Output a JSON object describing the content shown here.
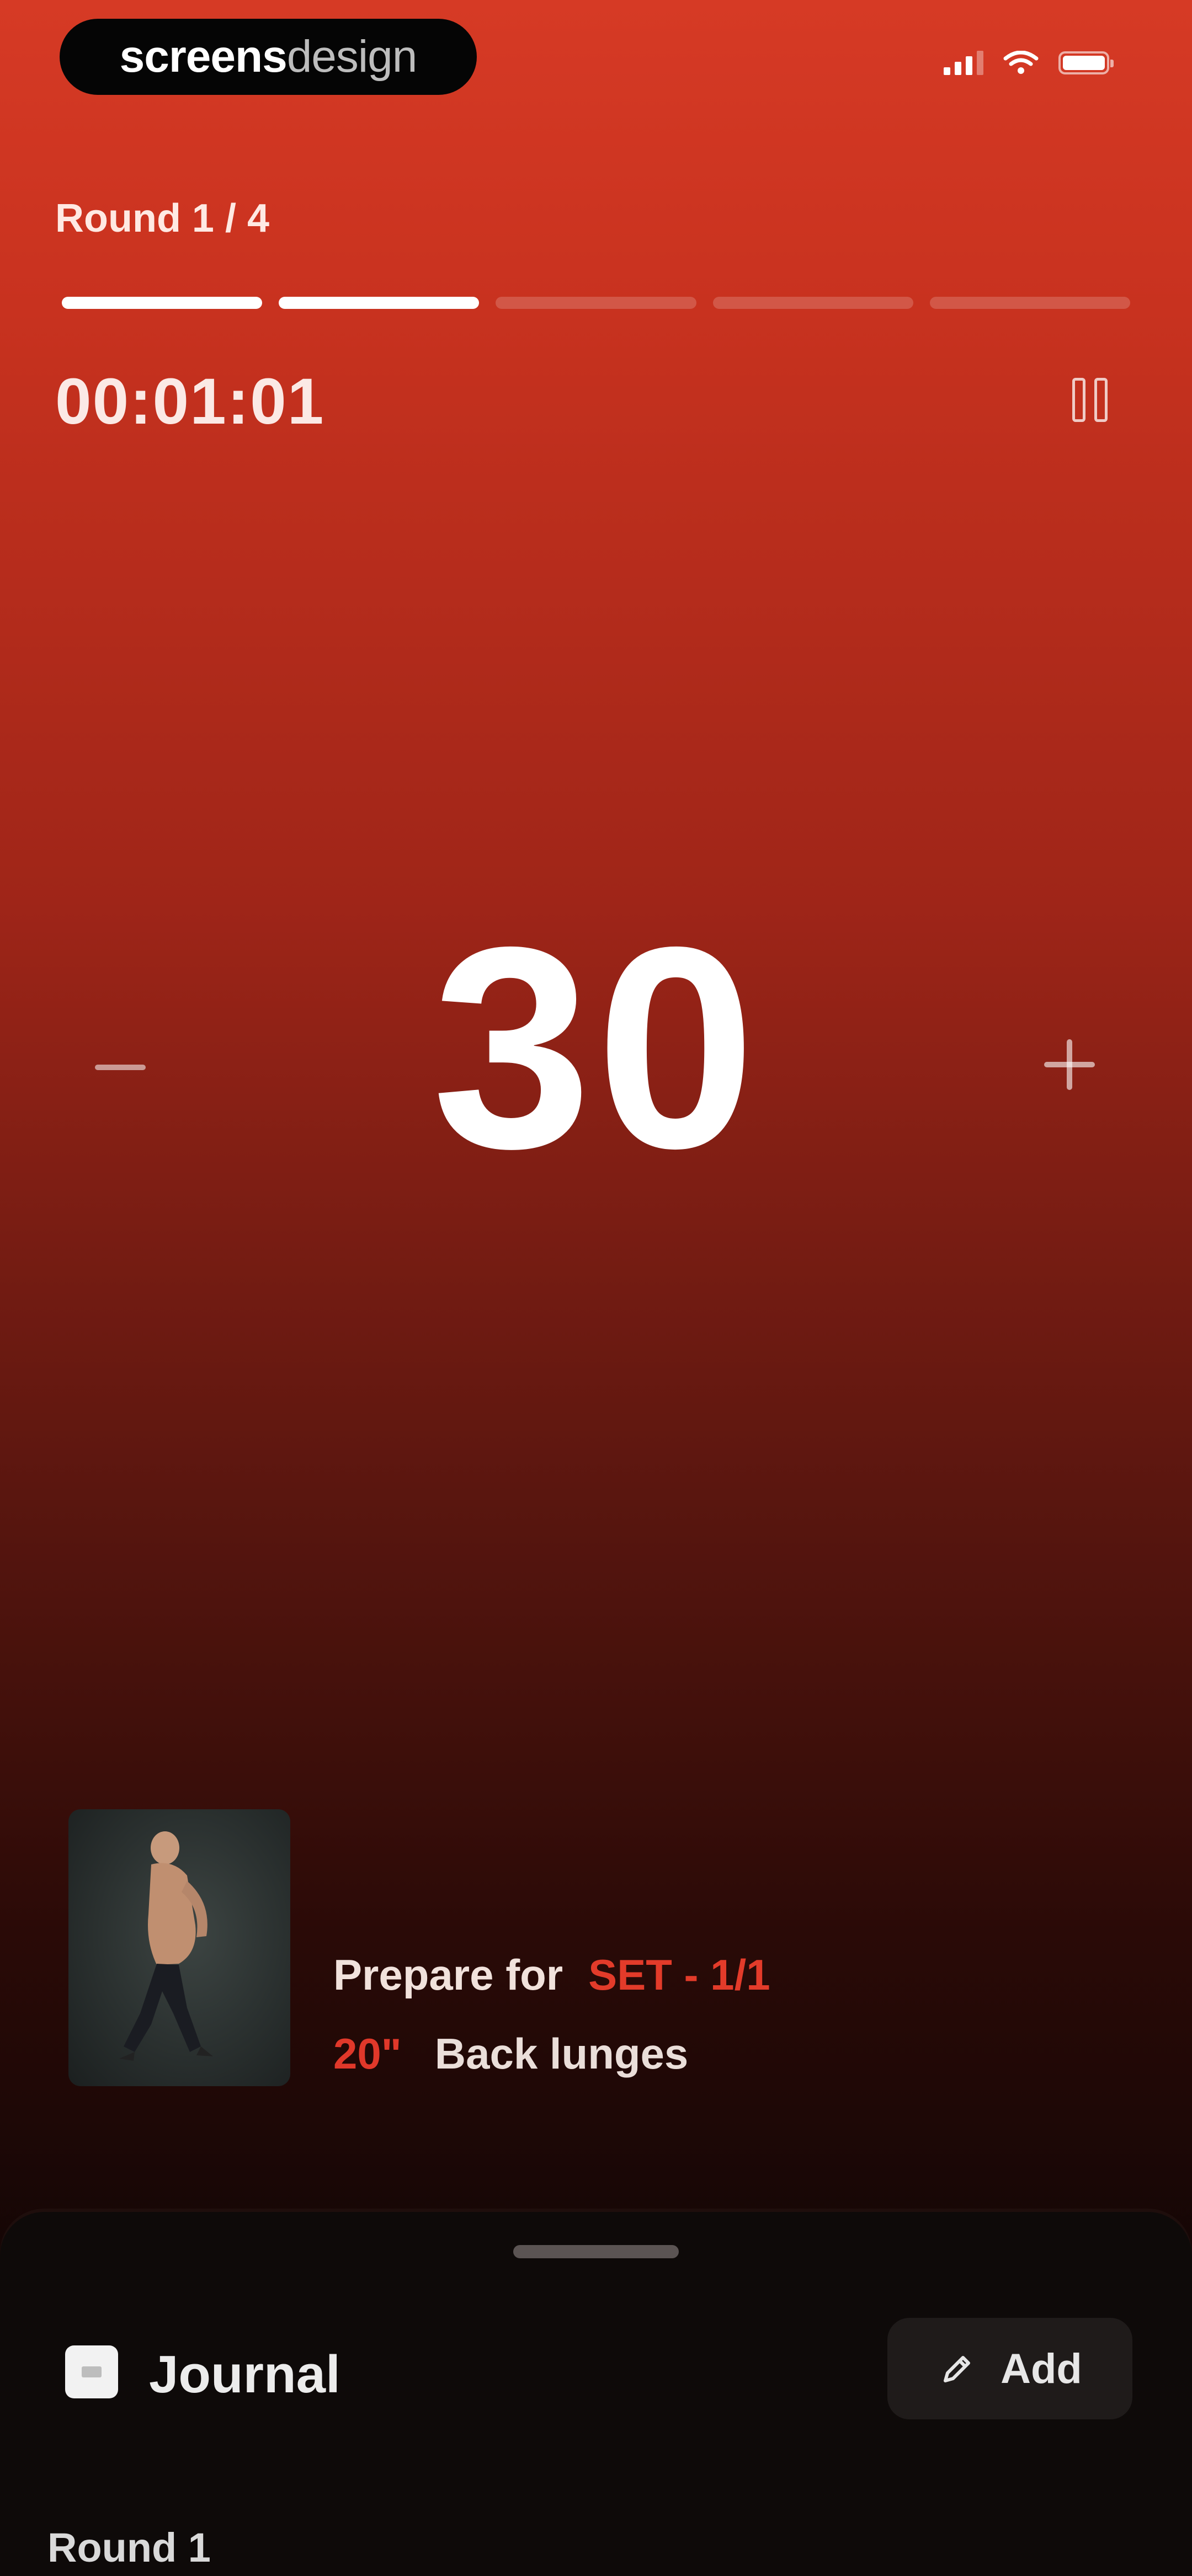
{
  "status_bar": {
    "brand_part1": "screens",
    "brand_part2": "design",
    "icons": [
      "signal-icon",
      "wifi-icon",
      "battery-icon"
    ]
  },
  "workout": {
    "round_label": "Round 1 / 4",
    "progress": {
      "segments_total": 5,
      "segments_completed": 2
    },
    "elapsed": "00:01:01",
    "counter": "30"
  },
  "next_exercise": {
    "prepare_label": "Prepare for",
    "set_label": "SET - 1/1",
    "duration": "20\"",
    "exercise_name": "Back lunges"
  },
  "journal": {
    "title": "Journal",
    "add_label": "Add",
    "first_round": "Round 1"
  },
  "colors": {
    "accent_red": "#e0382a",
    "gradient_top": "#d63a25",
    "gradient_bottom": "#0c0504",
    "sheet_bg": "#0e0a09"
  }
}
